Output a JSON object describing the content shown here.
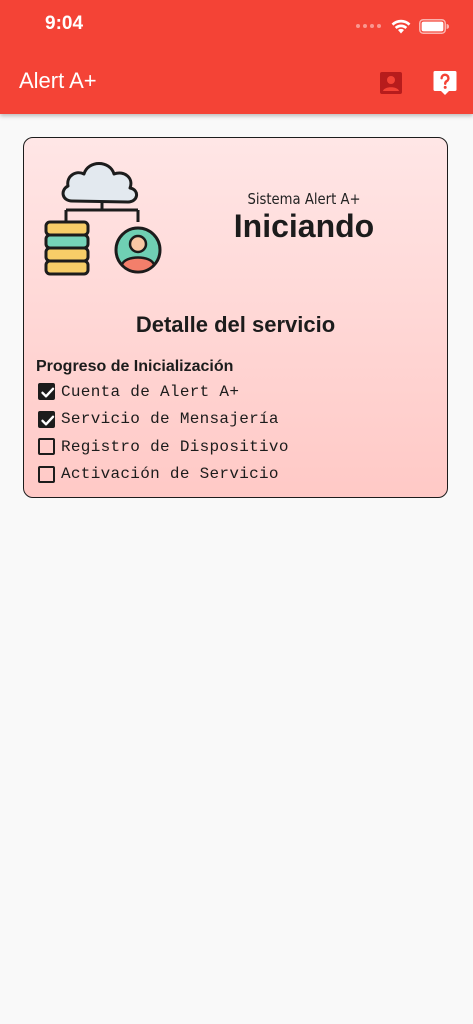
{
  "status_bar": {
    "time": "9:04"
  },
  "app_bar": {
    "title": "Alert A+",
    "background": "#f44336",
    "actions": [
      "contact-card-icon",
      "help-icon"
    ]
  },
  "card": {
    "system_label": "Sistema Alert A+",
    "status": "Iniciando",
    "detail_title": "Detalle del servicio",
    "progress_title": "Progreso de Inicialización",
    "steps": [
      {
        "label": "Cuenta de Alert A+",
        "checked": true
      },
      {
        "label": "Servicio de Mensajería",
        "checked": true
      },
      {
        "label": "Registro de Dispositivo",
        "checked": false
      },
      {
        "label": "Activación de Servicio",
        "checked": false
      }
    ]
  }
}
